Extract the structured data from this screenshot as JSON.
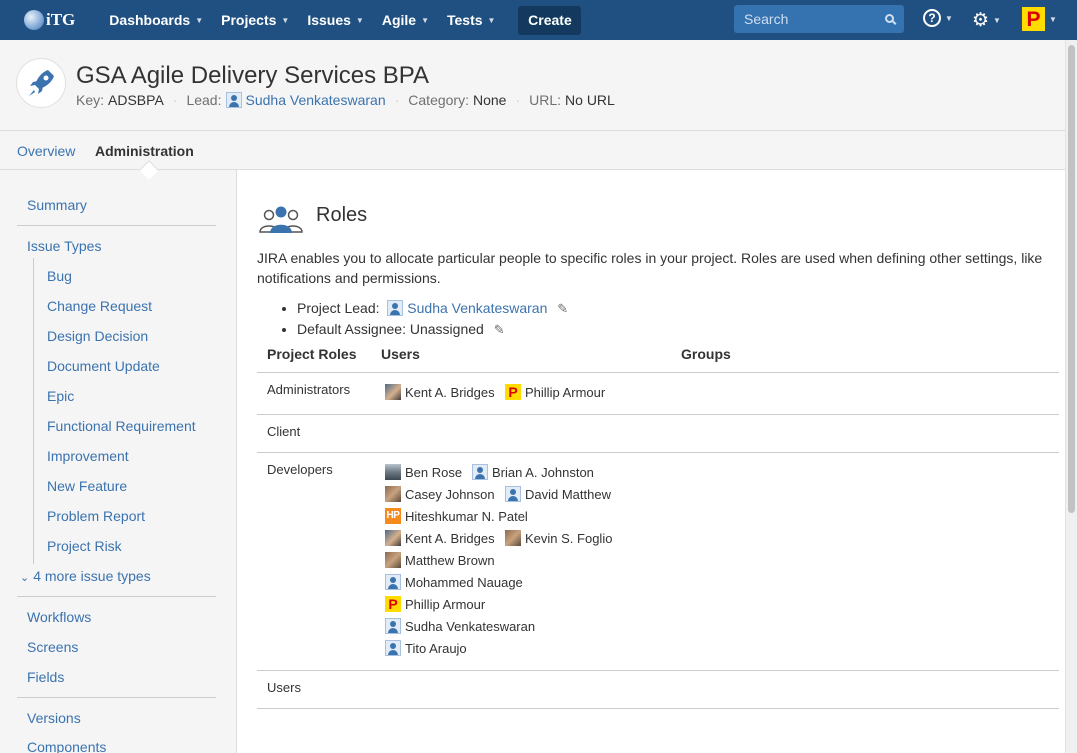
{
  "topnav": {
    "logo_text": "iTG",
    "menu": [
      {
        "label": "Dashboards"
      },
      {
        "label": "Projects"
      },
      {
        "label": "Issues"
      },
      {
        "label": "Agile"
      },
      {
        "label": "Tests"
      }
    ],
    "create_label": "Create",
    "search_placeholder": "Search",
    "help_glyph": "?",
    "user_avatar_letter": "P"
  },
  "project": {
    "title": "GSA Agile Delivery Services BPA",
    "key_label": "Key:",
    "key_value": "ADSBPA",
    "lead_label": "Lead:",
    "lead_value": "Sudha Venkateswaran",
    "category_label": "Category:",
    "category_value": "None",
    "url_label": "URL:",
    "url_value": "No URL"
  },
  "tabs": [
    {
      "label": "Overview",
      "active": false
    },
    {
      "label": "Administration",
      "active": true
    }
  ],
  "sidebar": {
    "summary": "Summary",
    "issue_types": "Issue Types",
    "issue_type_items": [
      "Bug",
      "Change Request",
      "Design Decision",
      "Document Update",
      "Epic",
      "Functional Requirement",
      "Improvement",
      "New Feature",
      "Problem Report",
      "Project Risk"
    ],
    "more_issue_types": "4 more issue types",
    "workflows": "Workflows",
    "screens": "Screens",
    "fields": "Fields",
    "versions": "Versions",
    "components": "Components"
  },
  "roles": {
    "title": "Roles",
    "intro": "JIRA enables you to allocate particular people to specific roles in your project. Roles are used when defining other settings, like notifications and permissions.",
    "project_lead_label": "Project Lead:",
    "project_lead_value": "Sudha Venkateswaran",
    "default_assignee_label": "Default Assignee:",
    "default_assignee_value": "Unassigned",
    "headers": {
      "roles": "Project Roles",
      "users": "Users",
      "groups": "Groups"
    },
    "rows": [
      {
        "name": "Administrators",
        "users": [
          "Kent A. Bridges",
          "Phillip Armour"
        ]
      },
      {
        "name": "Client",
        "users": []
      },
      {
        "name": "Developers",
        "users": [
          "Ben Rose",
          "Brian A. Johnston",
          "Casey Johnson",
          "David Matthew",
          "Hiteshkumar N. Patel",
          "Kent A. Bridges",
          "Kevin S. Foglio",
          "Matthew Brown",
          "Mohammed Nauage",
          "Phillip Armour",
          "Sudha Venkateswaran",
          "Tito Araujo"
        ]
      },
      {
        "name": "Users",
        "users": []
      }
    ]
  },
  "avatar_letters": {
    "p": "P",
    "hp": "HP"
  },
  "colors": {
    "nav": "#205081",
    "link": "#3b73af",
    "create": "#133a5e"
  }
}
